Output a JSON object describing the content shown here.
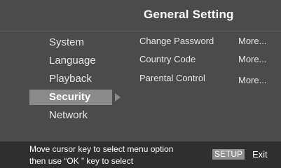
{
  "header": {
    "title": "General Setting"
  },
  "sidebar": {
    "items": [
      {
        "label": "System"
      },
      {
        "label": "Language"
      },
      {
        "label": "Playback"
      },
      {
        "label": "Security",
        "selected": true
      },
      {
        "label": "Network"
      }
    ]
  },
  "options": [
    {
      "label": "Change Password",
      "action": "More..."
    },
    {
      "label": "Country Code",
      "action": "More..."
    },
    {
      "label": "Parental Control",
      "action": "More..."
    }
  ],
  "footer": {
    "hint_line1": "Move cursor key to select menu option",
    "hint_line2": "then use “OK ” key to select",
    "setup_key": "SETUP",
    "exit_label": "Exit"
  },
  "colors": {
    "background": "#4b4b4b",
    "selected_row": "#8a8a8a",
    "footer": "#2f2f2f",
    "text": "#ffffff"
  }
}
